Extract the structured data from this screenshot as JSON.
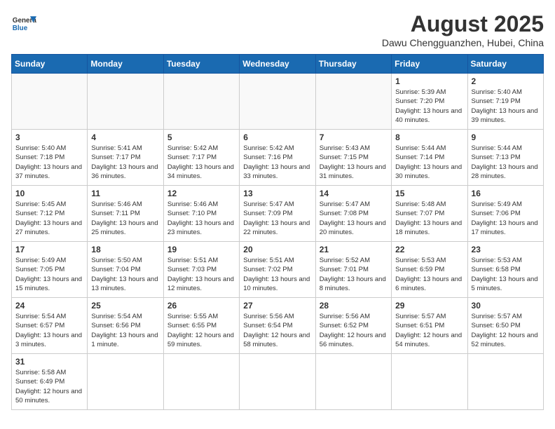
{
  "logo": {
    "general": "General",
    "blue": "Blue"
  },
  "header": {
    "title": "August 2025",
    "subtitle": "Dawu Chengguanzhen, Hubei, China"
  },
  "weekdays": [
    "Sunday",
    "Monday",
    "Tuesday",
    "Wednesday",
    "Thursday",
    "Friday",
    "Saturday"
  ],
  "weeks": [
    [
      {
        "day": "",
        "info": ""
      },
      {
        "day": "",
        "info": ""
      },
      {
        "day": "",
        "info": ""
      },
      {
        "day": "",
        "info": ""
      },
      {
        "day": "",
        "info": ""
      },
      {
        "day": "1",
        "info": "Sunrise: 5:39 AM\nSunset: 7:20 PM\nDaylight: 13 hours and 40 minutes."
      },
      {
        "day": "2",
        "info": "Sunrise: 5:40 AM\nSunset: 7:19 PM\nDaylight: 13 hours and 39 minutes."
      }
    ],
    [
      {
        "day": "3",
        "info": "Sunrise: 5:40 AM\nSunset: 7:18 PM\nDaylight: 13 hours and 37 minutes."
      },
      {
        "day": "4",
        "info": "Sunrise: 5:41 AM\nSunset: 7:17 PM\nDaylight: 13 hours and 36 minutes."
      },
      {
        "day": "5",
        "info": "Sunrise: 5:42 AM\nSunset: 7:17 PM\nDaylight: 13 hours and 34 minutes."
      },
      {
        "day": "6",
        "info": "Sunrise: 5:42 AM\nSunset: 7:16 PM\nDaylight: 13 hours and 33 minutes."
      },
      {
        "day": "7",
        "info": "Sunrise: 5:43 AM\nSunset: 7:15 PM\nDaylight: 13 hours and 31 minutes."
      },
      {
        "day": "8",
        "info": "Sunrise: 5:44 AM\nSunset: 7:14 PM\nDaylight: 13 hours and 30 minutes."
      },
      {
        "day": "9",
        "info": "Sunrise: 5:44 AM\nSunset: 7:13 PM\nDaylight: 13 hours and 28 minutes."
      }
    ],
    [
      {
        "day": "10",
        "info": "Sunrise: 5:45 AM\nSunset: 7:12 PM\nDaylight: 13 hours and 27 minutes."
      },
      {
        "day": "11",
        "info": "Sunrise: 5:46 AM\nSunset: 7:11 PM\nDaylight: 13 hours and 25 minutes."
      },
      {
        "day": "12",
        "info": "Sunrise: 5:46 AM\nSunset: 7:10 PM\nDaylight: 13 hours and 23 minutes."
      },
      {
        "day": "13",
        "info": "Sunrise: 5:47 AM\nSunset: 7:09 PM\nDaylight: 13 hours and 22 minutes."
      },
      {
        "day": "14",
        "info": "Sunrise: 5:47 AM\nSunset: 7:08 PM\nDaylight: 13 hours and 20 minutes."
      },
      {
        "day": "15",
        "info": "Sunrise: 5:48 AM\nSunset: 7:07 PM\nDaylight: 13 hours and 18 minutes."
      },
      {
        "day": "16",
        "info": "Sunrise: 5:49 AM\nSunset: 7:06 PM\nDaylight: 13 hours and 17 minutes."
      }
    ],
    [
      {
        "day": "17",
        "info": "Sunrise: 5:49 AM\nSunset: 7:05 PM\nDaylight: 13 hours and 15 minutes."
      },
      {
        "day": "18",
        "info": "Sunrise: 5:50 AM\nSunset: 7:04 PM\nDaylight: 13 hours and 13 minutes."
      },
      {
        "day": "19",
        "info": "Sunrise: 5:51 AM\nSunset: 7:03 PM\nDaylight: 13 hours and 12 minutes."
      },
      {
        "day": "20",
        "info": "Sunrise: 5:51 AM\nSunset: 7:02 PM\nDaylight: 13 hours and 10 minutes."
      },
      {
        "day": "21",
        "info": "Sunrise: 5:52 AM\nSunset: 7:01 PM\nDaylight: 13 hours and 8 minutes."
      },
      {
        "day": "22",
        "info": "Sunrise: 5:53 AM\nSunset: 6:59 PM\nDaylight: 13 hours and 6 minutes."
      },
      {
        "day": "23",
        "info": "Sunrise: 5:53 AM\nSunset: 6:58 PM\nDaylight: 13 hours and 5 minutes."
      }
    ],
    [
      {
        "day": "24",
        "info": "Sunrise: 5:54 AM\nSunset: 6:57 PM\nDaylight: 13 hours and 3 minutes."
      },
      {
        "day": "25",
        "info": "Sunrise: 5:54 AM\nSunset: 6:56 PM\nDaylight: 13 hours and 1 minute."
      },
      {
        "day": "26",
        "info": "Sunrise: 5:55 AM\nSunset: 6:55 PM\nDaylight: 12 hours and 59 minutes."
      },
      {
        "day": "27",
        "info": "Sunrise: 5:56 AM\nSunset: 6:54 PM\nDaylight: 12 hours and 58 minutes."
      },
      {
        "day": "28",
        "info": "Sunrise: 5:56 AM\nSunset: 6:52 PM\nDaylight: 12 hours and 56 minutes."
      },
      {
        "day": "29",
        "info": "Sunrise: 5:57 AM\nSunset: 6:51 PM\nDaylight: 12 hours and 54 minutes."
      },
      {
        "day": "30",
        "info": "Sunrise: 5:57 AM\nSunset: 6:50 PM\nDaylight: 12 hours and 52 minutes."
      }
    ],
    [
      {
        "day": "31",
        "info": "Sunrise: 5:58 AM\nSunset: 6:49 PM\nDaylight: 12 hours and 50 minutes."
      },
      {
        "day": "",
        "info": ""
      },
      {
        "day": "",
        "info": ""
      },
      {
        "day": "",
        "info": ""
      },
      {
        "day": "",
        "info": ""
      },
      {
        "day": "",
        "info": ""
      },
      {
        "day": "",
        "info": ""
      }
    ]
  ]
}
